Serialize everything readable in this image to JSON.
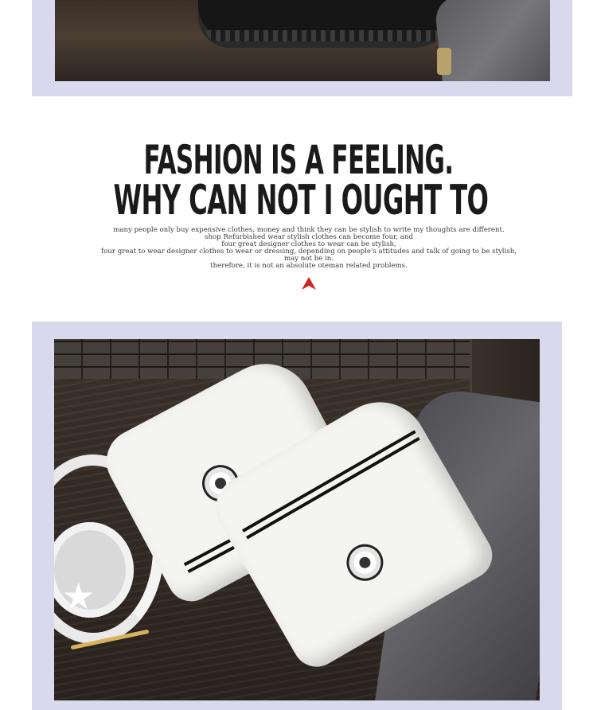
{
  "headline": {
    "line1": "FASHION IS A FEELING.",
    "line2": "WHY CAN NOT I OUGHT TO"
  },
  "body_copy": {
    "lines": [
      "many people only buy expensive clothes, money and think they can be stylish to write my thoughts are different.",
      "shop Refurbished wear stylish clothes can become four, and",
      "four great designer clothes to wear can be stylish,",
      "four great to wear designer clothes to wear or dressing, depending on people's attitudes and talk of going to be stylish,",
      "may not be in.",
      "therefore, it is not an absolute oteman related problems."
    ]
  },
  "colors": {
    "frame": "#d8d9ec",
    "accent_arrow": "#d31f1f"
  },
  "icons": {
    "arrow": "red-triangle-icon",
    "star": "star-icon"
  }
}
